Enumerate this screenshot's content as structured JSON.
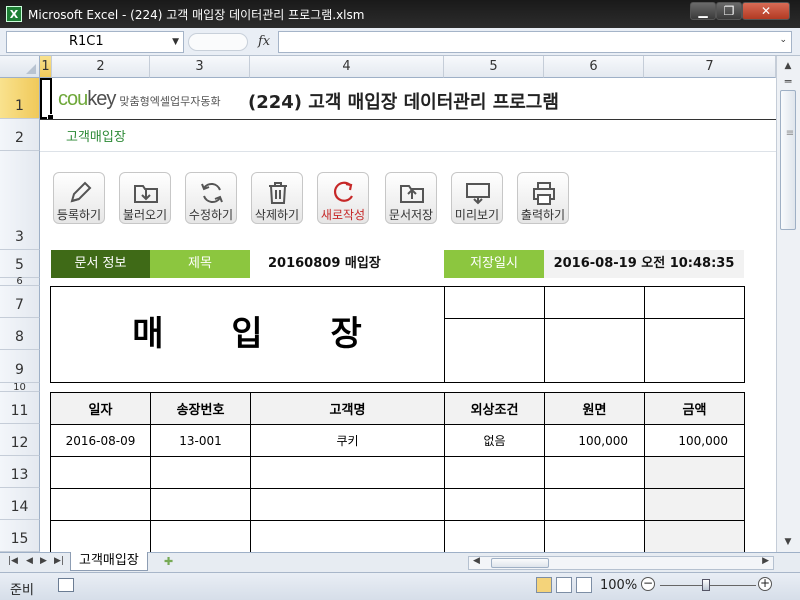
{
  "window": {
    "title": "Microsoft Excel - (224) 고객 매입장 데이터관리 프로그램.xlsm",
    "app_icon": "X",
    "minimize": "▁",
    "restore": "❐",
    "close": "✕"
  },
  "formula_bar": {
    "name_box": "R1C1",
    "fx": "fx",
    "formula": ""
  },
  "columns": [
    "1",
    "2",
    "3",
    "4",
    "5",
    "6",
    "7"
  ],
  "rows": [
    "1",
    "2",
    "3",
    "5",
    "6",
    "7",
    "8",
    "9",
    "10",
    "11",
    "12",
    "13",
    "14",
    "15"
  ],
  "header": {
    "logo_main": "cou",
    "logo_key": "key",
    "logo_sub": "맞춤형엑셀업무자동화",
    "title": "(224) 고객 매입장 데이터관리 프로그램"
  },
  "subtitle": "고객매입장",
  "toolbar": [
    {
      "label": "등록하기",
      "icon": "pencil-icon"
    },
    {
      "label": "불러오기",
      "icon": "folder-download-icon"
    },
    {
      "label": "수정하기",
      "icon": "refresh-icon"
    },
    {
      "label": "삭제하기",
      "icon": "trash-icon"
    },
    {
      "label": "새로작성",
      "icon": "new-icon"
    },
    {
      "label": "문서저장",
      "icon": "folder-upload-icon"
    },
    {
      "label": "미리보기",
      "icon": "monitor-icon"
    },
    {
      "label": "출력하기",
      "icon": "printer-icon"
    }
  ],
  "doc_info": {
    "label": "문서 정보",
    "title_label": "제목",
    "title_value": "20160809 매입장",
    "saved_label": "저장일시",
    "saved_value": "2016-08-19 오전 10:48:35"
  },
  "document": {
    "big_title": "매 입 장"
  },
  "table": {
    "headers": [
      "일자",
      "송장번호",
      "고객명",
      "외상조건",
      "원면",
      "금액"
    ],
    "rows": [
      [
        "2016-08-09",
        "13-001",
        "쿠키",
        "없음",
        "100,000",
        "100,000"
      ],
      [
        "",
        "",
        "",
        "",
        "",
        ""
      ],
      [
        "",
        "",
        "",
        "",
        "",
        ""
      ],
      [
        "",
        "",
        "",
        "",
        "",
        ""
      ]
    ]
  },
  "tabs": {
    "sheet": "고객매입장"
  },
  "status": {
    "ready": "준비",
    "zoom": "100%"
  },
  "colors": {
    "info_dark": "#3f6a17",
    "info_light": "#8cc63f",
    "logo_green": "#6fa83a",
    "accent_red": "#c62828"
  }
}
